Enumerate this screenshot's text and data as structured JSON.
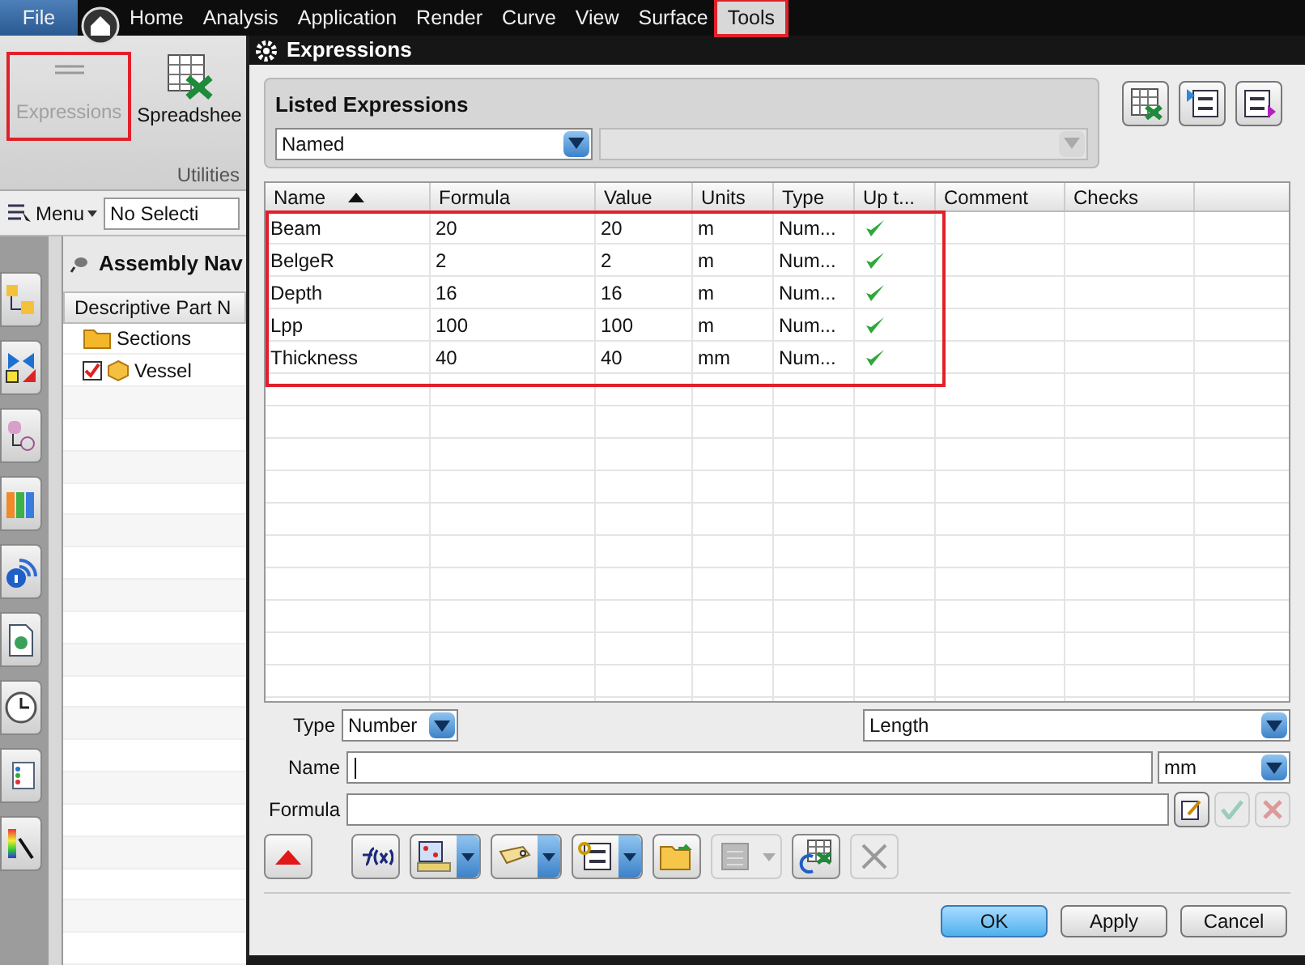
{
  "menu_bar": {
    "items": [
      {
        "label": "File",
        "highlighted": false,
        "kind": "file"
      },
      {
        "label": "Home",
        "highlighted": false,
        "kind": "menu"
      },
      {
        "label": "Analysis",
        "highlighted": false,
        "kind": "menu"
      },
      {
        "label": "Application",
        "highlighted": false,
        "kind": "menu"
      },
      {
        "label": "Render",
        "highlighted": false,
        "kind": "menu"
      },
      {
        "label": "Curve",
        "highlighted": false,
        "kind": "menu"
      },
      {
        "label": "View",
        "highlighted": false,
        "kind": "menu"
      },
      {
        "label": "Surface",
        "highlighted": false,
        "kind": "menu"
      },
      {
        "label": "Tools",
        "highlighted": true,
        "kind": "menu"
      }
    ]
  },
  "ribbon": {
    "buttons": [
      {
        "label": "Expressions",
        "highlighted": true,
        "disabled": true,
        "kind": "expressions"
      },
      {
        "label": "Spreadshee",
        "highlighted": false,
        "disabled": false,
        "kind": "spreadsheet"
      }
    ],
    "group_label": "Utilities"
  },
  "toolbar": {
    "menu_label": "Menu",
    "selection_filter": "No Selecti"
  },
  "navigator": {
    "title": "Assembly Nav",
    "column": "Descriptive Part N",
    "tree": [
      {
        "label": "Sections",
        "kind": "folder"
      },
      {
        "label": "Vessel",
        "kind": "part",
        "checked": true
      }
    ]
  },
  "dialog": {
    "title": "Expressions",
    "listed": {
      "label": "Listed Expressions",
      "filter": "Named"
    },
    "table": {
      "highlighted": true,
      "columns": [
        "Name",
        "Formula",
        "Value",
        "Units",
        "Type",
        "Up t...",
        "Comment",
        "Checks"
      ],
      "rows": [
        {
          "cells": [
            "Beam",
            "20",
            "20",
            "m",
            "Num..."
          ],
          "up_to_date": true
        },
        {
          "cells": [
            "BelgeR",
            "2",
            "2",
            "m",
            "Num..."
          ],
          "up_to_date": true
        },
        {
          "cells": [
            "Depth",
            "16",
            "16",
            "m",
            "Num..."
          ],
          "up_to_date": true
        },
        {
          "cells": [
            "Lpp",
            "100",
            "100",
            "m",
            "Num..."
          ],
          "up_to_date": true
        },
        {
          "cells": [
            "Thickness",
            "40",
            "40",
            "mm",
            "Num..."
          ],
          "up_to_date": true
        }
      ]
    },
    "type_label": "Type",
    "type_value": "Number",
    "dimensionality": "Length",
    "name_label": "Name",
    "units": "mm",
    "formula_label": "Formula",
    "buttons": [
      {
        "label": "OK",
        "default": true
      },
      {
        "label": "Apply",
        "default": false
      },
      {
        "label": "Cancel",
        "default": false
      }
    ]
  }
}
